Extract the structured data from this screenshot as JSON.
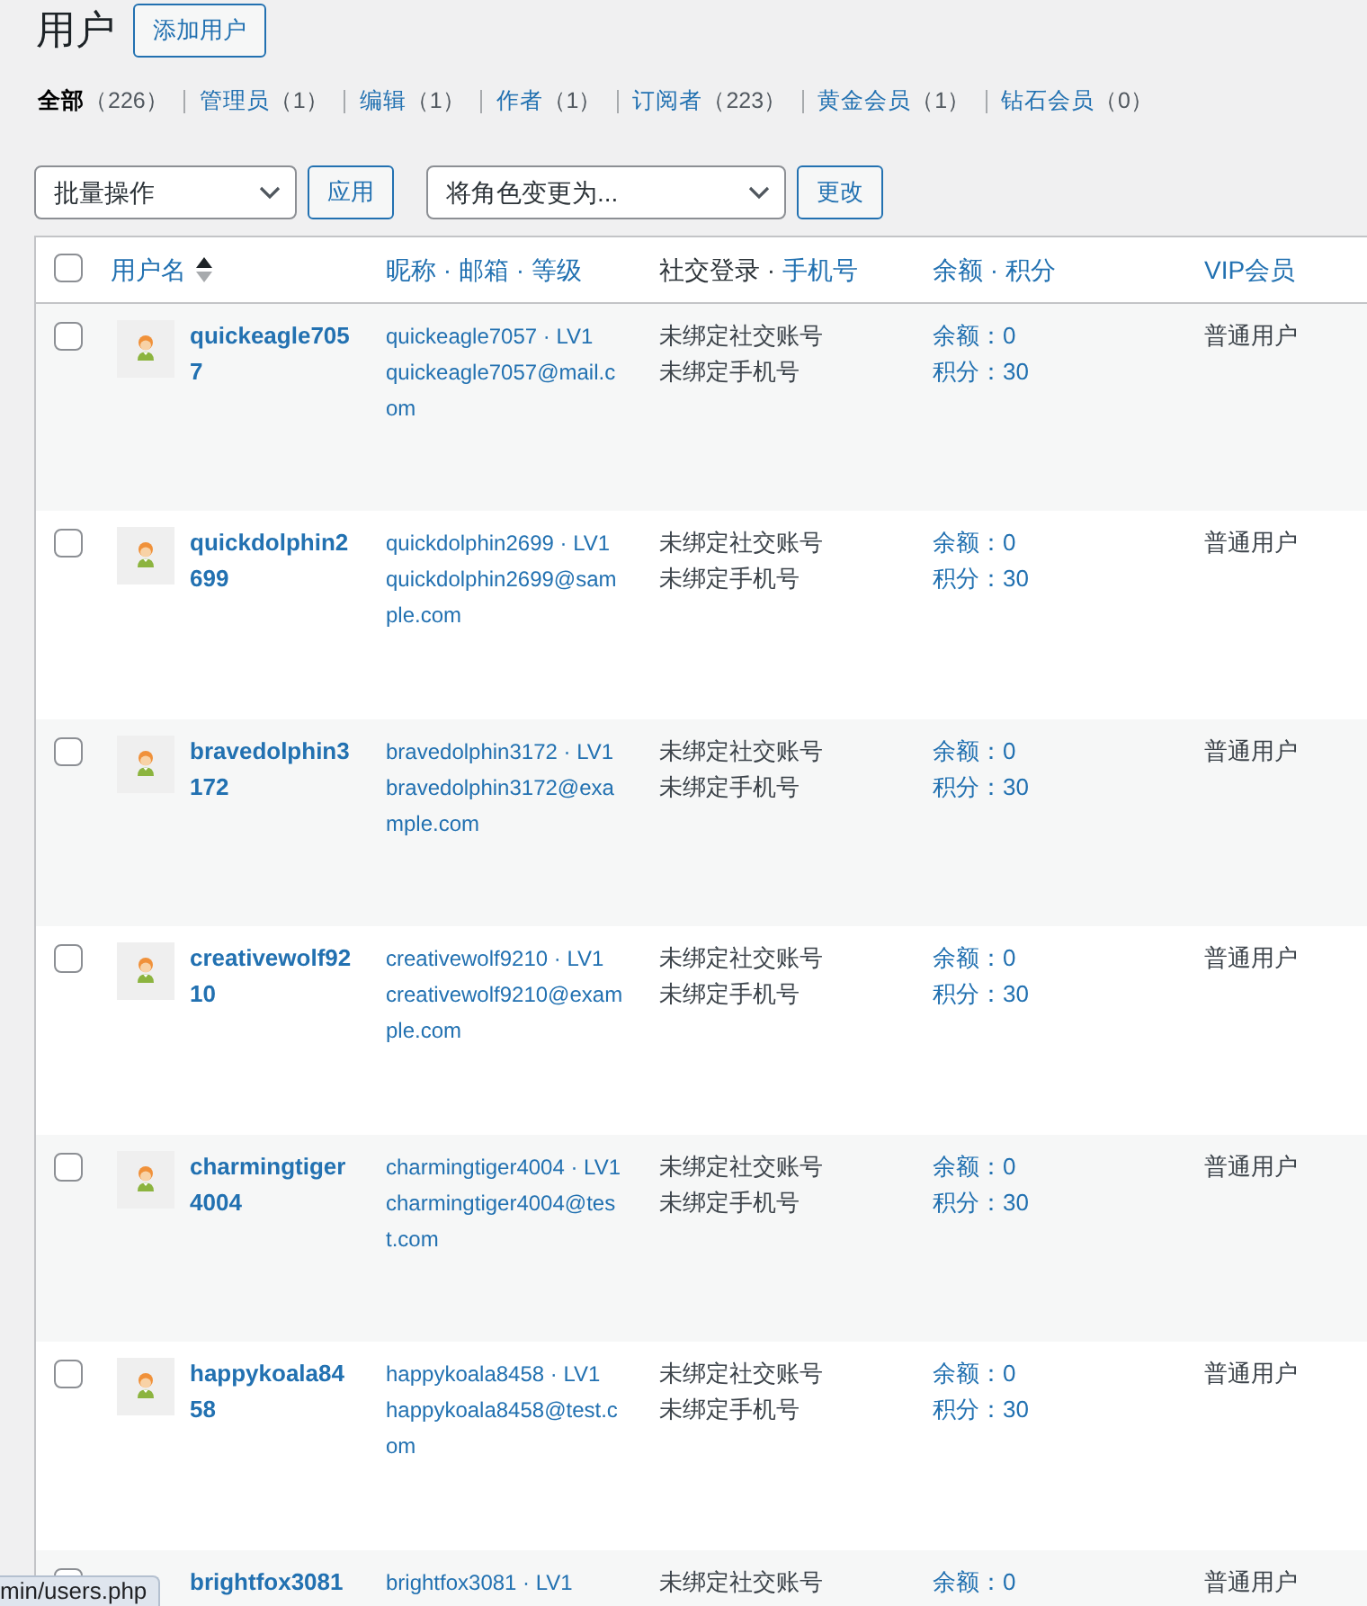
{
  "page": {
    "title": "用户",
    "add_button": "添加用户"
  },
  "filters": [
    {
      "label": "全部",
      "count": "（226）",
      "selected": true
    },
    {
      "label": "管理员",
      "count": "（1）",
      "selected": false
    },
    {
      "label": "编辑",
      "count": "（1）",
      "selected": false
    },
    {
      "label": "作者",
      "count": "（1）",
      "selected": false
    },
    {
      "label": "订阅者",
      "count": "（223）",
      "selected": false
    },
    {
      "label": "黄金会员",
      "count": "（1）",
      "selected": false
    },
    {
      "label": "钻石会员",
      "count": "（0）",
      "selected": false
    }
  ],
  "bulk_actions": {
    "select": "批量操作",
    "apply_button": "应用"
  },
  "role_change": {
    "select": "将角色变更为...",
    "change_button": "更改"
  },
  "table": {
    "select_all_checked": false,
    "columns": [
      {
        "parts": [
          {
            "text": "用户名",
            "kind": "link"
          }
        ],
        "sorted": true
      },
      {
        "parts": [
          {
            "text": "昵称 · 邮箱 · 等级",
            "kind": "link"
          }
        ],
        "sorted": false
      },
      {
        "parts": [
          {
            "text": "社交登录 ·",
            "kind": "plain"
          },
          {
            "text": "手机号",
            "kind": "link"
          }
        ],
        "sorted": false
      },
      {
        "parts": [
          {
            "text": "余额 · 积分",
            "kind": "link"
          }
        ],
        "sorted": false
      },
      {
        "parts": [
          {
            "text": "VIP会员",
            "kind": "link"
          }
        ],
        "sorted": false
      }
    ],
    "rows": [
      {
        "checked": false,
        "avatar": true,
        "username": "quickeagle7057",
        "nickname_line": "quickeagle7057 · LV1",
        "email": "quickeagle7057@mail.com",
        "social": [
          "未绑定社交账号",
          "未绑定手机号"
        ],
        "balance": [
          "余额：0",
          "积分：30"
        ],
        "vip": "普通用户"
      },
      {
        "checked": false,
        "avatar": true,
        "username": "quickdolphin2699",
        "nickname_line": "quickdolphin2699 · LV1",
        "email": "quickdolphin2699@sample.com",
        "social": [
          "未绑定社交账号",
          "未绑定手机号"
        ],
        "balance": [
          "余额：0",
          "积分：30"
        ],
        "vip": "普通用户"
      },
      {
        "checked": false,
        "avatar": true,
        "username": "bravedolphin3172",
        "nickname_line": "bravedolphin3172 · LV1",
        "email": "bravedolphin3172@example.com",
        "social": [
          "未绑定社交账号",
          "未绑定手机号"
        ],
        "balance": [
          "余额：0",
          "积分：30"
        ],
        "vip": "普通用户"
      },
      {
        "checked": false,
        "avatar": true,
        "username": "creativewolf9210",
        "nickname_line": "creativewolf9210 · LV1",
        "email": "creativewolf9210@example.com",
        "social": [
          "未绑定社交账号",
          "未绑定手机号"
        ],
        "balance": [
          "余额：0",
          "积分：30"
        ],
        "vip": "普通用户"
      },
      {
        "checked": false,
        "avatar": true,
        "username": "charmingtiger4004",
        "nickname_line": "charmingtiger4004 · LV1",
        "email": "charmingtiger4004@test.com",
        "social": [
          "未绑定社交账号",
          "未绑定手机号"
        ],
        "balance": [
          "余额：0",
          "积分：30"
        ],
        "vip": "普通用户"
      },
      {
        "checked": false,
        "avatar": true,
        "username": "happykoala8458",
        "nickname_line": "happykoala8458 · LV1",
        "email": "happykoala8458@test.com",
        "social": [
          "未绑定社交账号",
          "未绑定手机号"
        ],
        "balance": [
          "余额：0",
          "积分：30"
        ],
        "vip": "普通用户"
      },
      {
        "checked": false,
        "avatar": false,
        "username": "brightfox3081",
        "nickname_line": "brightfox3081 · LV1",
        "social": [
          "未绑定社交账号"
        ],
        "balance": [
          "余额：0"
        ],
        "vip": "普通用户"
      }
    ]
  },
  "link_preview": "min/users.php"
}
